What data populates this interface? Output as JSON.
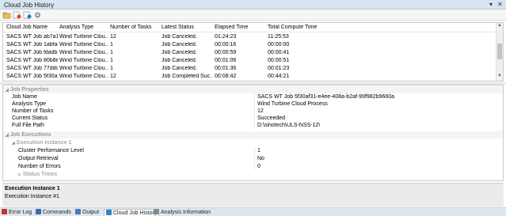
{
  "window": {
    "title": "Cloud Job History"
  },
  "toolbar": {
    "buttons": [
      "open-icon",
      "delete-icon",
      "refresh-icon",
      "settings-icon"
    ]
  },
  "grid": {
    "headers": [
      "Cloud Job Name",
      "Analysis Type",
      "Number of Tasks",
      "Latest Status",
      "Elapsed Time",
      "Total Compute Time"
    ],
    "rows": [
      [
        "SACS WT Job ab7a1e...",
        "Wind Turbine Clou...",
        "12",
        "Job Canceled.",
        "01:24:23",
        "11:25:53"
      ],
      [
        "SACS WT Job 1abfa4...",
        "Wind Turbine Clou...",
        "1",
        "Job Canceled.",
        "00:00:16",
        "00:00:00"
      ],
      [
        "SACS WT Job fdadb3...",
        "Wind Turbine Clou...",
        "1",
        "Job Canceled.",
        "00:00:59",
        "00:00:41"
      ],
      [
        "SACS WT Job 80b8e6...",
        "Wind Turbine Clou...",
        "1",
        "Job Canceled.",
        "00:01:06",
        "00:00:51"
      ],
      [
        "SACS WT Job 77ddd...",
        "Wind Turbine Clou...",
        "1",
        "Job Canceled.",
        "00:01:36",
        "00:01:23"
      ],
      [
        "SACS WT Job 5f30af3...",
        "Wind Turbine Clou...",
        "12",
        "Job Completed Suc...",
        "00:08:42",
        "00:44:21"
      ]
    ]
  },
  "properties": {
    "job_properties": {
      "header": "Job Properties",
      "items": [
        {
          "key": "Job Name",
          "value": "SACS WT Job 5f30af31-e4ee-408a-b2af-99f982b9660a"
        },
        {
          "key": "Analysis Type",
          "value": "Wind Turbine Cloud Process"
        },
        {
          "key": "Number of Tasks",
          "value": "12"
        },
        {
          "key": "Current Status",
          "value": "Succeeded"
        },
        {
          "key": "Full File Path",
          "value": "D:\\sinotech\\ULS-NSS-12\\"
        }
      ]
    },
    "job_executions": {
      "header": "Job Executions",
      "instance_header": "Execution Instance 1",
      "items": [
        {
          "key": "Cluster Performance Level",
          "value": "1"
        },
        {
          "key": "Output Retrieval",
          "value": "No"
        },
        {
          "key": "Number of Errors",
          "value": "0"
        }
      ],
      "status_times": "Status Times"
    }
  },
  "description": {
    "title": "Execution Instance 1",
    "text": "Execution Instance #1"
  },
  "tabs": [
    {
      "label": "Error Log",
      "color": "#c0392b"
    },
    {
      "label": "Commands",
      "color": "#3a6ea5"
    },
    {
      "label": "Output",
      "color": "#4a7bb7"
    },
    {
      "label": "Cloud Job History",
      "color": "#2e86c1"
    },
    {
      "label": "Analysis Information",
      "color": "#7f8c8d"
    }
  ],
  "active_tab": "Cloud Job History"
}
